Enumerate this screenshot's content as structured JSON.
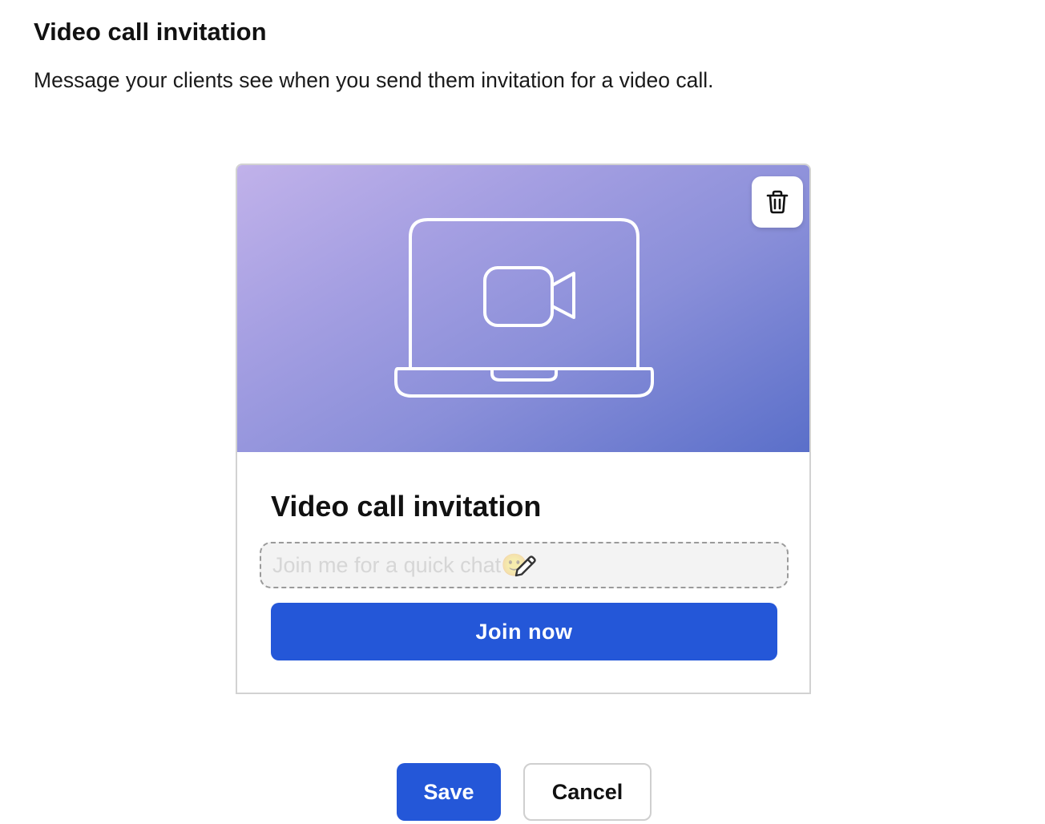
{
  "section": {
    "title": "Video call invitation",
    "description": "Message your clients see when you send them invitation for a video call."
  },
  "card": {
    "banner_gradient": [
      "#c1b2ea",
      "#a59fe2",
      "#8a8fd9",
      "#5a6fc9"
    ],
    "illustration_icon": "laptop-video-camera-icon",
    "delete_icon": "trash-icon",
    "title": "Video call invitation",
    "message_placeholder": "Join me for a quick chat",
    "message_emoji": "🙂",
    "edit_icon": "pencil-icon",
    "join_label": "Join now"
  },
  "actions": {
    "save_label": "Save",
    "cancel_label": "Cancel"
  },
  "colors": {
    "primary": "#2457d8",
    "text": "#111111",
    "border": "#d2d2d2"
  }
}
